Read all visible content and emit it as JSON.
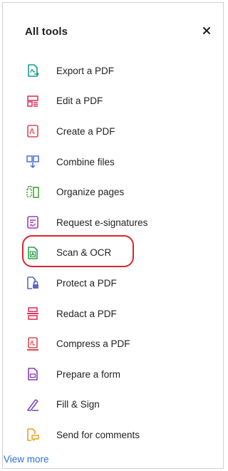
{
  "panel": {
    "title": "All tools",
    "close_icon": "close-icon"
  },
  "tools": [
    {
      "label": "Export a PDF",
      "icon": "export-pdf-icon",
      "color": "#1a9b8c"
    },
    {
      "label": "Edit a PDF",
      "icon": "edit-pdf-icon",
      "color": "#e0365d"
    },
    {
      "label": "Create a PDF",
      "icon": "create-pdf-icon",
      "color": "#e34850"
    },
    {
      "label": "Combine files",
      "icon": "combine-files-icon",
      "color": "#4a6fd8"
    },
    {
      "label": "Organize pages",
      "icon": "organize-pages-icon",
      "color": "#46a43a"
    },
    {
      "label": "Request e-signatures",
      "icon": "request-esignatures-icon",
      "color": "#9c3fb5"
    },
    {
      "label": "Scan & OCR",
      "icon": "scan-ocr-icon",
      "color": "#2f9e4a"
    },
    {
      "label": "Protect a PDF",
      "icon": "protect-pdf-icon",
      "color": "#5a67c8"
    },
    {
      "label": "Redact a PDF",
      "icon": "redact-pdf-icon",
      "color": "#e0365d"
    },
    {
      "label": "Compress a PDF",
      "icon": "compress-pdf-icon",
      "color": "#e34850"
    },
    {
      "label": "Prepare a form",
      "icon": "prepare-form-icon",
      "color": "#8b3fb5"
    },
    {
      "label": "Fill & Sign",
      "icon": "fill-sign-icon",
      "color": "#7a4cc8"
    },
    {
      "label": "Send for comments",
      "icon": "send-for-comments-icon",
      "color": "#e6a21a"
    }
  ],
  "highlighted_tool": "Scan & OCR",
  "highlight_color": "#d9262c",
  "view_more": "View more",
  "link_color": "#2f6fd6"
}
